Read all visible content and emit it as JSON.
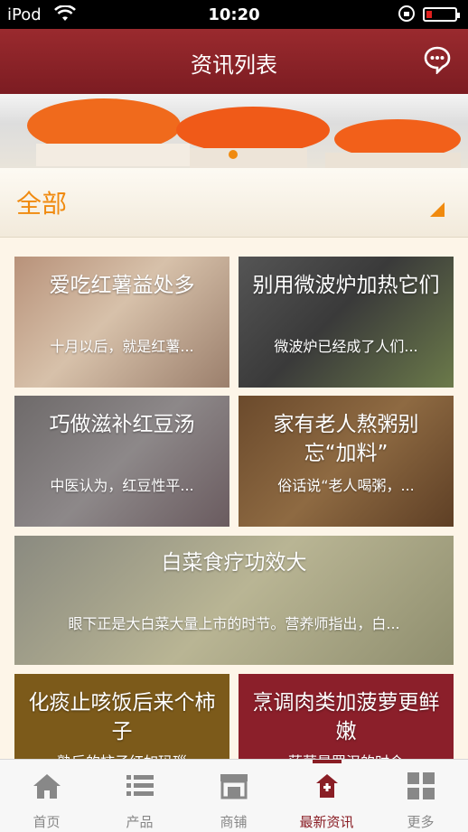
{
  "status": {
    "carrier": "iPod",
    "time": "10:20"
  },
  "header": {
    "title": "资讯列表"
  },
  "filter": {
    "label": "全部"
  },
  "news": [
    {
      "title": "爱吃红薯益处多",
      "desc": "十月以后，就是红薯..."
    },
    {
      "title": "别用微波炉加热它们",
      "desc": "微波炉已经成了人们..."
    },
    {
      "title": "巧做滋补红豆汤",
      "desc": "中医认为，红豆性平..."
    },
    {
      "title": "家有老人熬粥别忘“加料”",
      "desc": "俗话说“老人喝粥，..."
    },
    {
      "title": "白菜食疗功效大",
      "desc": "眼下正是大白菜大量上市的时节。营养师指出，白..."
    },
    {
      "title": "化痰止咳饭后来个柿子",
      "desc": "熟后的柿子红如玛瑙"
    },
    {
      "title": "烹调肉类加菠萝更鲜嫩",
      "desc": "菠萝是罗汉的时令"
    }
  ],
  "tabs": [
    {
      "label": "首页",
      "icon": "home-icon"
    },
    {
      "label": "产品",
      "icon": "list-icon"
    },
    {
      "label": "商铺",
      "icon": "store-icon"
    },
    {
      "label": "最新资讯",
      "icon": "news-icon"
    },
    {
      "label": "更多",
      "icon": "grid-icon"
    }
  ],
  "colors": {
    "brand": "#8a1e25",
    "accent": "#f08a0f"
  }
}
